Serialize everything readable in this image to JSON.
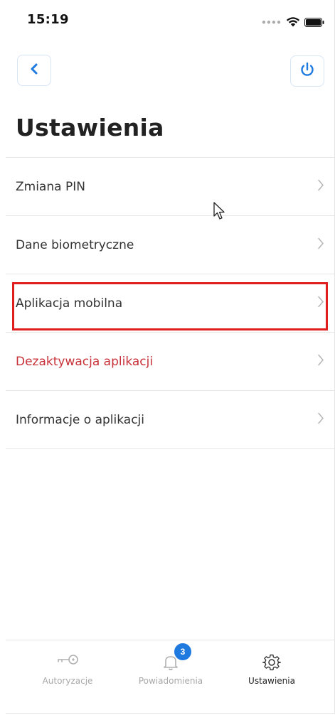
{
  "status_bar": {
    "time": "15:19"
  },
  "header": {
    "title": "Ustawienia"
  },
  "menu": {
    "items": [
      {
        "label": "Zmiana PIN"
      },
      {
        "label": "Dane biometryczne"
      },
      {
        "label": "Aplikacja mobilna"
      },
      {
        "label": "Dezaktywacja aplikacji"
      },
      {
        "label": "Informacje o aplikacji"
      }
    ]
  },
  "tabbar": {
    "tabs": [
      {
        "label": "Autoryzacje"
      },
      {
        "label": "Powiadomienia",
        "badge": "3"
      },
      {
        "label": "Ustawienia"
      }
    ]
  },
  "colors": {
    "accent": "#1f7ae0",
    "danger": "#c8313a",
    "highlight": "#e01e1e"
  }
}
